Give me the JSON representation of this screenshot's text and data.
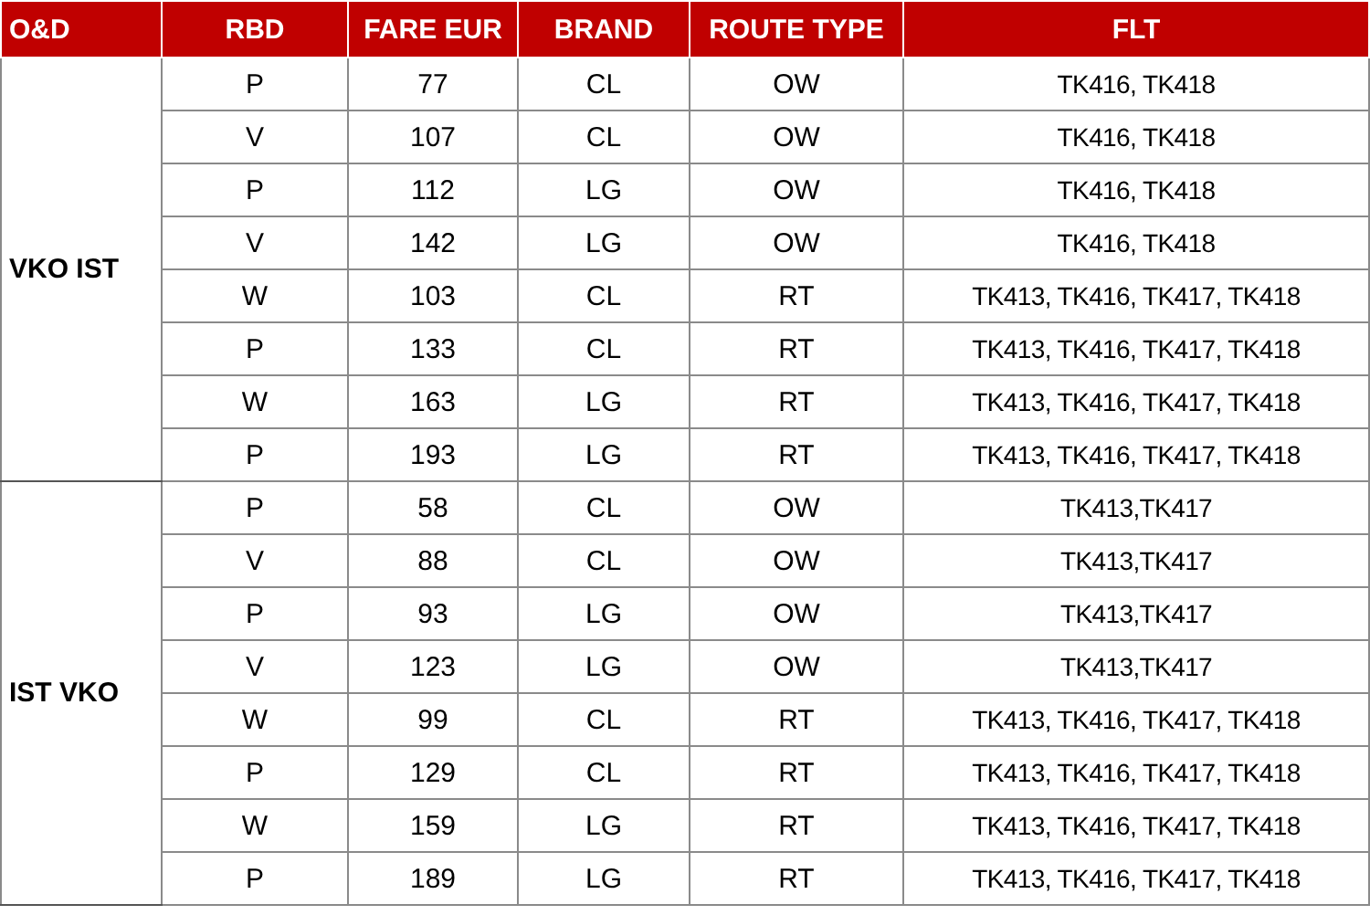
{
  "table": {
    "columns": [
      "O&D",
      "RBD",
      "FARE EUR",
      "BRAND",
      "ROUTE TYPE",
      "FLT"
    ],
    "groups": [
      {
        "od": "VKO IST",
        "rows": [
          [
            "P",
            "77",
            "CL",
            "OW",
            "TK416, TK418"
          ],
          [
            "V",
            "107",
            "CL",
            "OW",
            "TK416, TK418"
          ],
          [
            "P",
            "112",
            "LG",
            "OW",
            "TK416, TK418"
          ],
          [
            "V",
            "142",
            "LG",
            "OW",
            "TK416, TK418"
          ],
          [
            "W",
            "103",
            "CL",
            "RT",
            "TK413, TK416, TK417, TK418"
          ],
          [
            "P",
            "133",
            "CL",
            "RT",
            "TK413, TK416, TK417, TK418"
          ],
          [
            "W",
            "163",
            "LG",
            "RT",
            "TK413, TK416, TK417, TK418"
          ],
          [
            "P",
            "193",
            "LG",
            "RT",
            "TK413, TK416, TK417, TK418"
          ]
        ]
      },
      {
        "od": "IST VKO",
        "rows": [
          [
            "P",
            "58",
            "CL",
            "OW",
            "TK413,TK417"
          ],
          [
            "V",
            "88",
            "CL",
            "OW",
            "TK413,TK417"
          ],
          [
            "P",
            "93",
            "LG",
            "OW",
            "TK413,TK417"
          ],
          [
            "V",
            "123",
            "LG",
            "OW",
            "TK413,TK417"
          ],
          [
            "W",
            "99",
            "CL",
            "RT",
            "TK413, TK416, TK417, TK418"
          ],
          [
            "P",
            "129",
            "CL",
            "RT",
            "TK413, TK416, TK417, TK418"
          ],
          [
            "W",
            "159",
            "LG",
            "RT",
            "TK413, TK416, TK417, TK418"
          ],
          [
            "P",
            "189",
            "LG",
            "RT",
            "TK413, TK416, TK417, TK418"
          ]
        ]
      }
    ]
  }
}
